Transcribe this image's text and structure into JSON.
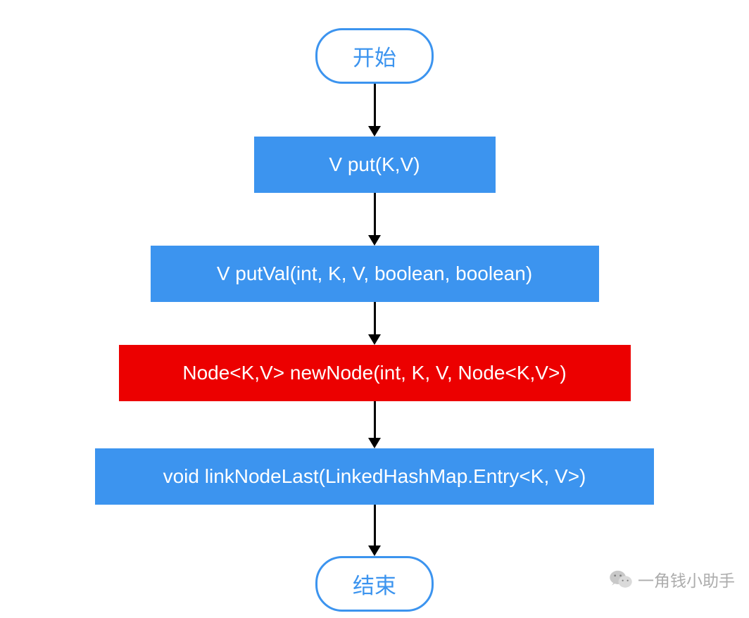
{
  "flowchart": {
    "start": "开始",
    "step1": "V put(K,V)",
    "step2": "V putVal(int, K, V, boolean, boolean)",
    "step3": "Node<K,V> newNode(int, K, V, Node<K,V>)",
    "step4": "void linkNodeLast(LinkedHashMap.Entry<K, V>)",
    "end": "结束"
  },
  "watermark": {
    "text": "一角钱小助手"
  },
  "colors": {
    "primary_blue": "#3c94ef",
    "accent_red": "#ec0000",
    "arrow": "#000000",
    "watermark_gray": "#9e9e9e"
  }
}
